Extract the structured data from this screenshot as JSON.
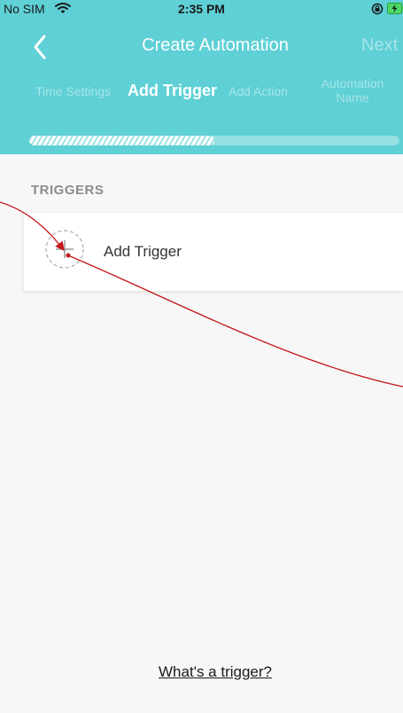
{
  "status_bar": {
    "carrier": "No SIM",
    "time": "2:35 PM",
    "wifi_icon": "wifi-icon",
    "orientation_icon": "orientation-lock-icon",
    "battery_icon": "battery-charging-icon"
  },
  "nav": {
    "title": "Create Automation",
    "next_label": "Next",
    "back_icon": "chevron-left-icon"
  },
  "steps": [
    {
      "label": "Time Settings",
      "state": "done"
    },
    {
      "label": "Add Trigger",
      "state": "active"
    },
    {
      "label": "Add Action",
      "state": "pending"
    },
    {
      "label": "Automation Name",
      "state": "pending"
    }
  ],
  "progress": {
    "fraction": 0.5
  },
  "triggers_section": {
    "label": "TRIGGERS",
    "add_label": "Add Trigger",
    "add_icon": "plus-circle-icon"
  },
  "help_link": "What's a trigger?",
  "colors": {
    "header_bg": "#5ed0d6",
    "content_bg": "#f7f7f7",
    "annotation": "#c4161c"
  }
}
